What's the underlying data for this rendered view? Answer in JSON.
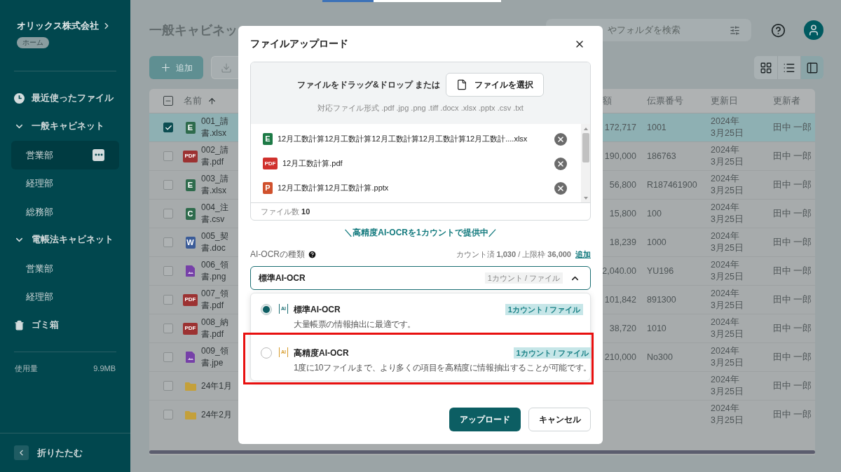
{
  "sidebar": {
    "company": "オリックス株式会社",
    "home_tag": "ホーム",
    "items": [
      {
        "kind": "recent",
        "label": "最近使ったファイル"
      },
      {
        "kind": "cabinet",
        "label": "一般キャビネット",
        "expanded": true,
        "children": [
          {
            "label": "営業部",
            "selected": true
          },
          {
            "label": "経理部",
            "selected": false
          },
          {
            "label": "総務部",
            "selected": false
          }
        ]
      },
      {
        "kind": "cabinet",
        "label": "電帳法キャビネット",
        "expanded": true,
        "children": [
          {
            "label": "営業部",
            "selected": false
          },
          {
            "label": "経理部",
            "selected": false
          }
        ]
      },
      {
        "kind": "trash",
        "label": "ゴミ箱"
      }
    ],
    "usage": {
      "label": "使用量",
      "value": "9.9MB"
    },
    "collapse": "折りたたむ"
  },
  "header": {
    "title": "一般キャビネッ",
    "search_placeholder": "やフォルダを検索"
  },
  "toolbar": {
    "add": "追加",
    "views": [
      {
        "kind": "grid",
        "selected": false
      },
      {
        "kind": "list",
        "selected": false
      },
      {
        "kind": "panel",
        "selected": true
      }
    ]
  },
  "table": {
    "header_checkbox": {
      "indeterminate": true
    },
    "columns": {
      "name": "名前",
      "amount": "額",
      "slip": "伝票番号",
      "updated": "更新日",
      "updater": "更新者"
    },
    "rows": [
      {
        "kind": "xlsx",
        "badge": "E",
        "name_lines": [
          "001_請",
          "書.xlsx"
        ],
        "amount": "172,717",
        "slip": "1001",
        "date": "2024年\n3月25日",
        "updater": "田中 一郎",
        "checked": true
      },
      {
        "kind": "pdf",
        "badge": "PDF",
        "name_lines": [
          "002_請",
          "書.pdf"
        ],
        "amount": "190,000",
        "slip": "186763",
        "date": "2024年\n3月25日",
        "updater": "田中 一郎",
        "checked": false
      },
      {
        "kind": "xlsx",
        "badge": "E",
        "name_lines": [
          "003_請",
          "書.xlsx"
        ],
        "amount": "56,800",
        "slip": "R187461900",
        "date": "2024年\n3月25日",
        "updater": "田中 一郎",
        "checked": false
      },
      {
        "kind": "csv",
        "badge": "C",
        "name_lines": [
          "004_注",
          "書.csv"
        ],
        "amount": "15,800",
        "slip": "100",
        "date": "2024年\n3月25日",
        "updater": "田中 一郎",
        "checked": false
      },
      {
        "kind": "docx",
        "badge": "W",
        "name_lines": [
          "005_契",
          "書.doc"
        ],
        "amount": "18,239",
        "slip": "1000",
        "date": "2024年\n3月25日",
        "updater": "田中 一郎",
        "checked": false
      },
      {
        "kind": "image",
        "name_lines": [
          "006_領",
          "書.png"
        ],
        "amount": "2,040.00",
        "slip": "YU196",
        "date": "2024年\n3月25日",
        "updater": "田中 一郎",
        "checked": false
      },
      {
        "kind": "pdf",
        "badge": "PDF",
        "name_lines": [
          "007_領",
          "書.pdf"
        ],
        "amount": "101,842",
        "slip": "891300",
        "date": "2024年\n3月25日",
        "updater": "田中 一郎",
        "checked": false
      },
      {
        "kind": "pdf",
        "badge": "PDF",
        "name_lines": [
          "008_納",
          "書.pdf"
        ],
        "amount": "38,720",
        "slip": "1010",
        "date": "2024年\n3月25日",
        "updater": "田中 一郎",
        "checked": false
      },
      {
        "kind": "image",
        "name_lines": [
          "009_領",
          "書.jpe"
        ],
        "amount": "210,000",
        "slip": "No300",
        "date": "2024年\n3月25日",
        "updater": "田中 一郎",
        "checked": false
      },
      {
        "kind": "folder",
        "name_lines": [
          "24年1月"
        ],
        "date": "2024年\n3月25日",
        "updater": "田中 一郎",
        "checked": false
      },
      {
        "kind": "folder",
        "name_lines": [
          "24年2月"
        ],
        "date": "2024年\n3月25日",
        "updater": "田中 一郎",
        "checked": false
      }
    ]
  },
  "modal": {
    "title": "ファイルアップロード",
    "drop_text": "ファイルをドラッグ&ドロップ または",
    "select_button": "ファイルを選択",
    "formats": "対応ファイル形式 .pdf .jpg .png .tiff .docx .xlsx .pptx .csv .txt",
    "files": [
      {
        "kind": "xlsx",
        "badge": "E",
        "name": "12月工数計算12月工数計算12月工数計算12月工数計算12月工数計....xlsx"
      },
      {
        "kind": "pdf",
        "badge": "PDF",
        "name": "12月工数計算.pdf"
      },
      {
        "kind": "pptx",
        "badge": "P",
        "name": "12月工数計算12月工数計算.pptx"
      }
    ],
    "file_count": "ファイル数 **10**",
    "promo": "＼高精度AI-OCRを1カウントで提供中／",
    "ocr_label": "AI-OCRの種類",
    "usage": "カウント済 **1,030** / 上限枠 **36,000**",
    "add_link": "追加",
    "select": {
      "value": "標準AI-OCR",
      "cost": "1カウント / ファイル",
      "expanded": true
    },
    "options": [
      {
        "kind": "standard",
        "icon_text": "AI",
        "label": "標準AI-OCR",
        "cost": "1カウント / ファイル",
        "description": "大量帳票の情報抽出に最適です。",
        "selected": true,
        "annotated": false
      },
      {
        "kind": "premium",
        "icon_text": "AI",
        "label": "高精度AI-OCR",
        "cost": "1カウント / ファイル",
        "description": "1度に10ファイルまで、より多くの項目を高精度に情報抽出することが可能です。",
        "selected": false,
        "annotated": true
      }
    ],
    "buttons": {
      "upload": "アップロード",
      "cancel": "キャンセル"
    }
  }
}
